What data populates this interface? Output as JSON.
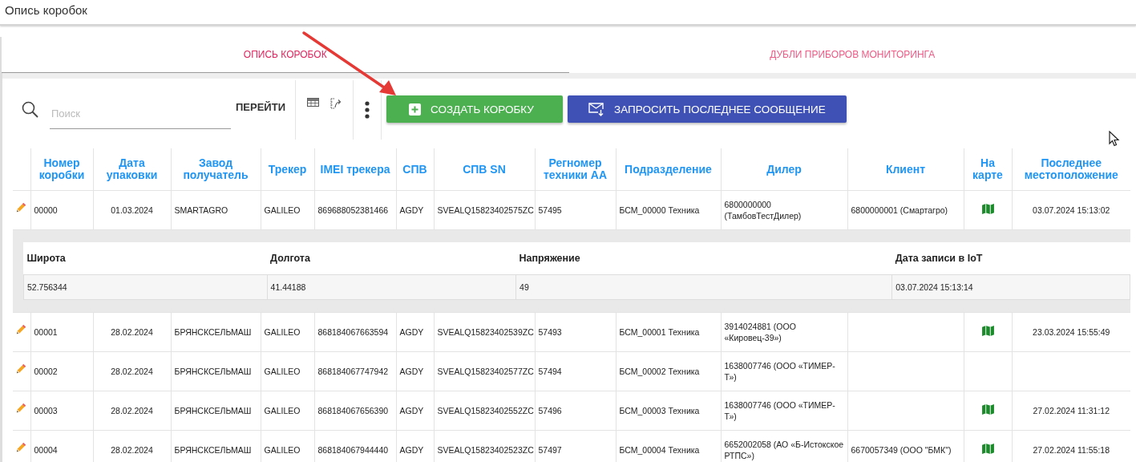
{
  "page": {
    "title": "Опись коробок"
  },
  "tabs": [
    {
      "label": "ОПИСЬ КОРОБОК",
      "selected": true
    },
    {
      "label": "ДУБЛИ ПРИБОРОВ МОНИТОРИНГА",
      "selected": false
    }
  ],
  "toolbar": {
    "search": {
      "placeholder": "Поиск"
    },
    "go_button": "ПЕРЕЙТИ",
    "create_button": "СОЗДАТЬ КОРОБКУ",
    "request_button": "ЗАПРОСИТЬ ПОСЛЕДНЕЕ СООБЩЕНИЕ"
  },
  "table": {
    "columns": [
      "Номер коробки",
      "Дата упаковки",
      "Завод получатель",
      "Трекер",
      "IMEI трекера",
      "СПВ",
      "СПВ SN",
      "Регномер техники АА",
      "Подразделение",
      "Дилер",
      "Клиент",
      "На карте",
      "Последнее местоположение"
    ],
    "rows": [
      {
        "number": "00000",
        "date": "01.03.2024",
        "plant": "SMARTAGRO",
        "tracker": "GALILEO",
        "imei": "869688052381466",
        "spv": "AGDY",
        "spv_sn": "SVEALQ15823402575ZC",
        "regnum": "57495",
        "division": "БСМ_00000 Техника",
        "dealer": "6800000000 (ТамбовТестДилер)",
        "client": "6800000001 (Смартагро)",
        "on_map": true,
        "last_location": "03.07.2024 15:13:02",
        "details": {
          "columns": [
            "Широта",
            "Долгота",
            "Напряжение",
            "Дата записи в IoT"
          ],
          "values": [
            "52.756344",
            "41.44188",
            "49",
            "03.07.2024 15:13:14"
          ]
        }
      },
      {
        "number": "00001",
        "date": "28.02.2024",
        "plant": "БРЯНСКСЕЛЬМАШ",
        "tracker": "GALILEO",
        "imei": "868184067663594",
        "spv": "AGDY",
        "spv_sn": "SVEALQ15823402539ZC",
        "regnum": "57493",
        "division": "БСМ_00001 Техника",
        "dealer": "3914024881 (ООО «Кировец-39»)",
        "on_map": true,
        "last_location": "23.03.2024 15:55:49"
      },
      {
        "number": "00002",
        "date": "28.02.2024",
        "plant": "БРЯНСКСЕЛЬМАШ",
        "tracker": "GALILEO",
        "imei": "868184067747942",
        "spv": "AGDY",
        "spv_sn": "SVEALQ15823402577ZC",
        "regnum": "57494",
        "division": "БСМ_00002 Техника",
        "dealer": "1638007746 (ООО «ТИМЕР-Т»)",
        "on_map": false
      },
      {
        "number": "00003",
        "date": "28.02.2024",
        "plant": "БРЯНСКСЕЛЬМАШ",
        "tracker": "GALILEO",
        "imei": "868184067656390",
        "spv": "AGDY",
        "spv_sn": "SVEALQ15823402552ZC",
        "regnum": "57496",
        "division": "БСМ_00003 Техника",
        "dealer": "1638007746 (ООО «ТИМЕР-Т»)",
        "on_map": true,
        "last_location": "27.02.2024 11:31:12"
      },
      {
        "number": "00004",
        "date": "28.02.2024",
        "plant": "БРЯНСКСЕЛЬМАШ",
        "tracker": "GALILEO",
        "imei": "868184067944440",
        "spv": "AGDY",
        "spv_sn": "SVEALQ15823402523ZC",
        "regnum": "57497",
        "division": "БСМ_00004 Техника",
        "dealer": "6652002058 (АО «Б-Истокское РТПС»)",
        "client": "6670057349 (ООО \"БМК\")",
        "on_map": true,
        "last_location": "27.02.2024 11:55:18"
      }
    ]
  }
}
